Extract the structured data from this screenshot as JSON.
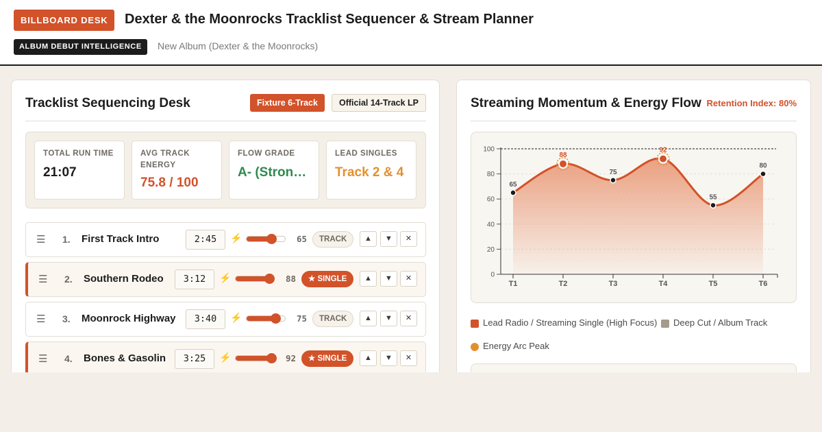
{
  "header": {
    "brand": "BILLBOARD DESK",
    "title": "Dexter & the Moonrocks Tracklist Sequencer & Stream Planner",
    "section_badge": "ALBUM DEBUT INTELLIGENCE",
    "subtitle": "New Album (Dexter & the Moonrocks)"
  },
  "sequencer": {
    "title": "Tracklist Sequencing Desk",
    "mode_buttons": [
      "Fixture 6-Track",
      "Official 14-Track LP"
    ],
    "active_mode": "Fixture 6-Track",
    "stats": [
      {
        "label": "TOTAL RUN TIME",
        "value": "21:07",
        "color": "#1c1c1c"
      },
      {
        "label": "AVG TRACK ENERGY",
        "value": "75.8 / 100",
        "color": "#d2522a"
      },
      {
        "label": "FLOW GRADE",
        "value": "A- (Strong Flow)",
        "color": "#2f8a4d"
      },
      {
        "label": "LEAD SINGLES",
        "value": "Track 2 & 4",
        "color": "#e2902e"
      }
    ],
    "tracks": [
      {
        "num": "1.",
        "name": "First Track Intro",
        "time": "2:45",
        "energy": "65",
        "energy_level": 65,
        "tag": "TRACK",
        "single": false
      },
      {
        "num": "2.",
        "name": "Southern Rodeo",
        "time": "3:12",
        "energy": "88",
        "energy_level": 88,
        "tag": "★ SINGLE",
        "single": true
      },
      {
        "num": "3.",
        "name": "Moonrock Highway",
        "time": "3:40",
        "energy": "75",
        "energy_level": 75,
        "tag": "TRACK",
        "single": false
      },
      {
        "num": "4.",
        "name": "Bones & Gasolin",
        "time": "3:25",
        "energy": "92",
        "energy_level": 92,
        "tag": "★ SINGLE",
        "single": true
      }
    ],
    "controls": {
      "up": "▲",
      "down": "▼",
      "remove": "✕",
      "drag": "☰",
      "energy_icon": "⚡"
    }
  },
  "momentum": {
    "title": "Streaming Momentum & Energy Flow",
    "retention": "Retention Index: 80%",
    "legend": [
      {
        "label": "Lead Radio / Streaming Single (High Focus)",
        "color": "#d2522a",
        "shape": "square"
      },
      {
        "label": "Deep Cut / Album Track",
        "color": "#a39b8c",
        "shape": "square"
      },
      {
        "label": "Energy Arc Peak",
        "color": "#e2902e",
        "shape": "circle"
      }
    ]
  },
  "chart_data": {
    "type": "area",
    "x": [
      "T1",
      "T2",
      "T3",
      "T4",
      "T5",
      "T6"
    ],
    "series": [
      {
        "values": [
          65,
          88,
          75,
          92,
          55,
          80
        ],
        "singles": [
          false,
          true,
          false,
          true,
          false,
          false
        ]
      }
    ],
    "ylim": [
      0,
      100
    ],
    "yticks": [
      0,
      20,
      40,
      60,
      80,
      100
    ],
    "reference_line": 100,
    "grid": true,
    "line_color": "#d2522a",
    "fill_color": "#e8916d"
  }
}
